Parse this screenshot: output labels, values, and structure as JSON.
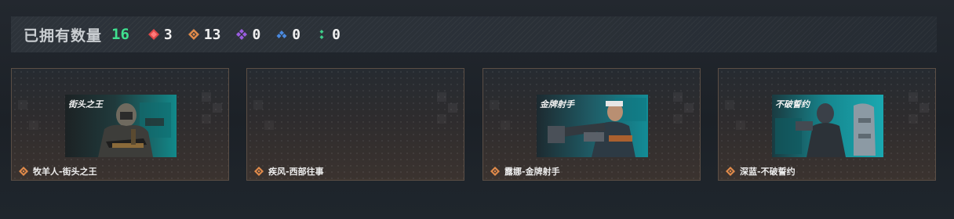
{
  "header": {
    "title": "已拥有数量",
    "total": "16",
    "total_color": "#3fe08f",
    "rarity_counts": [
      {
        "icon": "red-diamond-icon",
        "color": "#e04848",
        "value": "3"
      },
      {
        "icon": "orange-diamond-icon",
        "color": "#e08a4a",
        "value": "13"
      },
      {
        "icon": "purple-diamond-cluster-icon",
        "color": "#9a5ce0",
        "value": "0"
      },
      {
        "icon": "blue-diamond-cluster-icon",
        "color": "#4a8ae0",
        "value": "0"
      },
      {
        "icon": "green-dots-icon",
        "color": "#3fcf8a",
        "value": "0"
      }
    ]
  },
  "cards": [
    {
      "label": "牧羊人-街头之王",
      "has_image": true,
      "image_caption": "街头之王",
      "rarity_icon": "orange-diamond-icon"
    },
    {
      "label": "疾风-西部往事",
      "has_image": false,
      "rarity_icon": "orange-diamond-icon"
    },
    {
      "label": "露娜-金牌射手",
      "has_image": true,
      "image_caption": "金牌射手",
      "rarity_icon": "orange-diamond-icon"
    },
    {
      "label": "深蓝-不破誓约",
      "has_image": true,
      "image_caption": "不破誓约",
      "rarity_icon": "orange-diamond-icon"
    }
  ]
}
